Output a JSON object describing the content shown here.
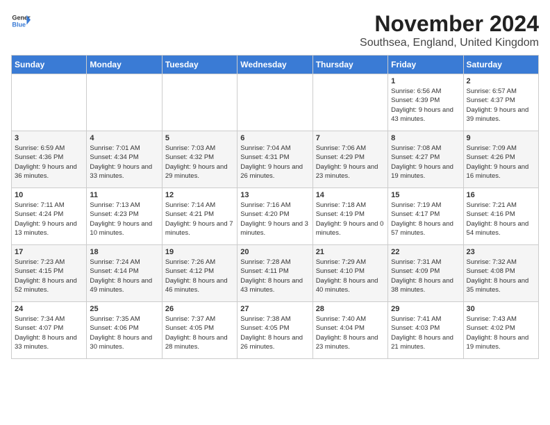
{
  "header": {
    "logo_line1": "General",
    "logo_line2": "Blue",
    "month_year": "November 2024",
    "location": "Southsea, England, United Kingdom"
  },
  "days_of_week": [
    "Sunday",
    "Monday",
    "Tuesday",
    "Wednesday",
    "Thursday",
    "Friday",
    "Saturday"
  ],
  "weeks": [
    [
      {
        "day": "",
        "details": ""
      },
      {
        "day": "",
        "details": ""
      },
      {
        "day": "",
        "details": ""
      },
      {
        "day": "",
        "details": ""
      },
      {
        "day": "",
        "details": ""
      },
      {
        "day": "1",
        "details": "Sunrise: 6:56 AM\nSunset: 4:39 PM\nDaylight: 9 hours and 43 minutes."
      },
      {
        "day": "2",
        "details": "Sunrise: 6:57 AM\nSunset: 4:37 PM\nDaylight: 9 hours and 39 minutes."
      }
    ],
    [
      {
        "day": "3",
        "details": "Sunrise: 6:59 AM\nSunset: 4:36 PM\nDaylight: 9 hours and 36 minutes."
      },
      {
        "day": "4",
        "details": "Sunrise: 7:01 AM\nSunset: 4:34 PM\nDaylight: 9 hours and 33 minutes."
      },
      {
        "day": "5",
        "details": "Sunrise: 7:03 AM\nSunset: 4:32 PM\nDaylight: 9 hours and 29 minutes."
      },
      {
        "day": "6",
        "details": "Sunrise: 7:04 AM\nSunset: 4:31 PM\nDaylight: 9 hours and 26 minutes."
      },
      {
        "day": "7",
        "details": "Sunrise: 7:06 AM\nSunset: 4:29 PM\nDaylight: 9 hours and 23 minutes."
      },
      {
        "day": "8",
        "details": "Sunrise: 7:08 AM\nSunset: 4:27 PM\nDaylight: 9 hours and 19 minutes."
      },
      {
        "day": "9",
        "details": "Sunrise: 7:09 AM\nSunset: 4:26 PM\nDaylight: 9 hours and 16 minutes."
      }
    ],
    [
      {
        "day": "10",
        "details": "Sunrise: 7:11 AM\nSunset: 4:24 PM\nDaylight: 9 hours and 13 minutes."
      },
      {
        "day": "11",
        "details": "Sunrise: 7:13 AM\nSunset: 4:23 PM\nDaylight: 9 hours and 10 minutes."
      },
      {
        "day": "12",
        "details": "Sunrise: 7:14 AM\nSunset: 4:21 PM\nDaylight: 9 hours and 7 minutes."
      },
      {
        "day": "13",
        "details": "Sunrise: 7:16 AM\nSunset: 4:20 PM\nDaylight: 9 hours and 3 minutes."
      },
      {
        "day": "14",
        "details": "Sunrise: 7:18 AM\nSunset: 4:19 PM\nDaylight: 9 hours and 0 minutes."
      },
      {
        "day": "15",
        "details": "Sunrise: 7:19 AM\nSunset: 4:17 PM\nDaylight: 8 hours and 57 minutes."
      },
      {
        "day": "16",
        "details": "Sunrise: 7:21 AM\nSunset: 4:16 PM\nDaylight: 8 hours and 54 minutes."
      }
    ],
    [
      {
        "day": "17",
        "details": "Sunrise: 7:23 AM\nSunset: 4:15 PM\nDaylight: 8 hours and 52 minutes."
      },
      {
        "day": "18",
        "details": "Sunrise: 7:24 AM\nSunset: 4:14 PM\nDaylight: 8 hours and 49 minutes."
      },
      {
        "day": "19",
        "details": "Sunrise: 7:26 AM\nSunset: 4:12 PM\nDaylight: 8 hours and 46 minutes."
      },
      {
        "day": "20",
        "details": "Sunrise: 7:28 AM\nSunset: 4:11 PM\nDaylight: 8 hours and 43 minutes."
      },
      {
        "day": "21",
        "details": "Sunrise: 7:29 AM\nSunset: 4:10 PM\nDaylight: 8 hours and 40 minutes."
      },
      {
        "day": "22",
        "details": "Sunrise: 7:31 AM\nSunset: 4:09 PM\nDaylight: 8 hours and 38 minutes."
      },
      {
        "day": "23",
        "details": "Sunrise: 7:32 AM\nSunset: 4:08 PM\nDaylight: 8 hours and 35 minutes."
      }
    ],
    [
      {
        "day": "24",
        "details": "Sunrise: 7:34 AM\nSunset: 4:07 PM\nDaylight: 8 hours and 33 minutes."
      },
      {
        "day": "25",
        "details": "Sunrise: 7:35 AM\nSunset: 4:06 PM\nDaylight: 8 hours and 30 minutes."
      },
      {
        "day": "26",
        "details": "Sunrise: 7:37 AM\nSunset: 4:05 PM\nDaylight: 8 hours and 28 minutes."
      },
      {
        "day": "27",
        "details": "Sunrise: 7:38 AM\nSunset: 4:05 PM\nDaylight: 8 hours and 26 minutes."
      },
      {
        "day": "28",
        "details": "Sunrise: 7:40 AM\nSunset: 4:04 PM\nDaylight: 8 hours and 23 minutes."
      },
      {
        "day": "29",
        "details": "Sunrise: 7:41 AM\nSunset: 4:03 PM\nDaylight: 8 hours and 21 minutes."
      },
      {
        "day": "30",
        "details": "Sunrise: 7:43 AM\nSunset: 4:02 PM\nDaylight: 8 hours and 19 minutes."
      }
    ]
  ]
}
